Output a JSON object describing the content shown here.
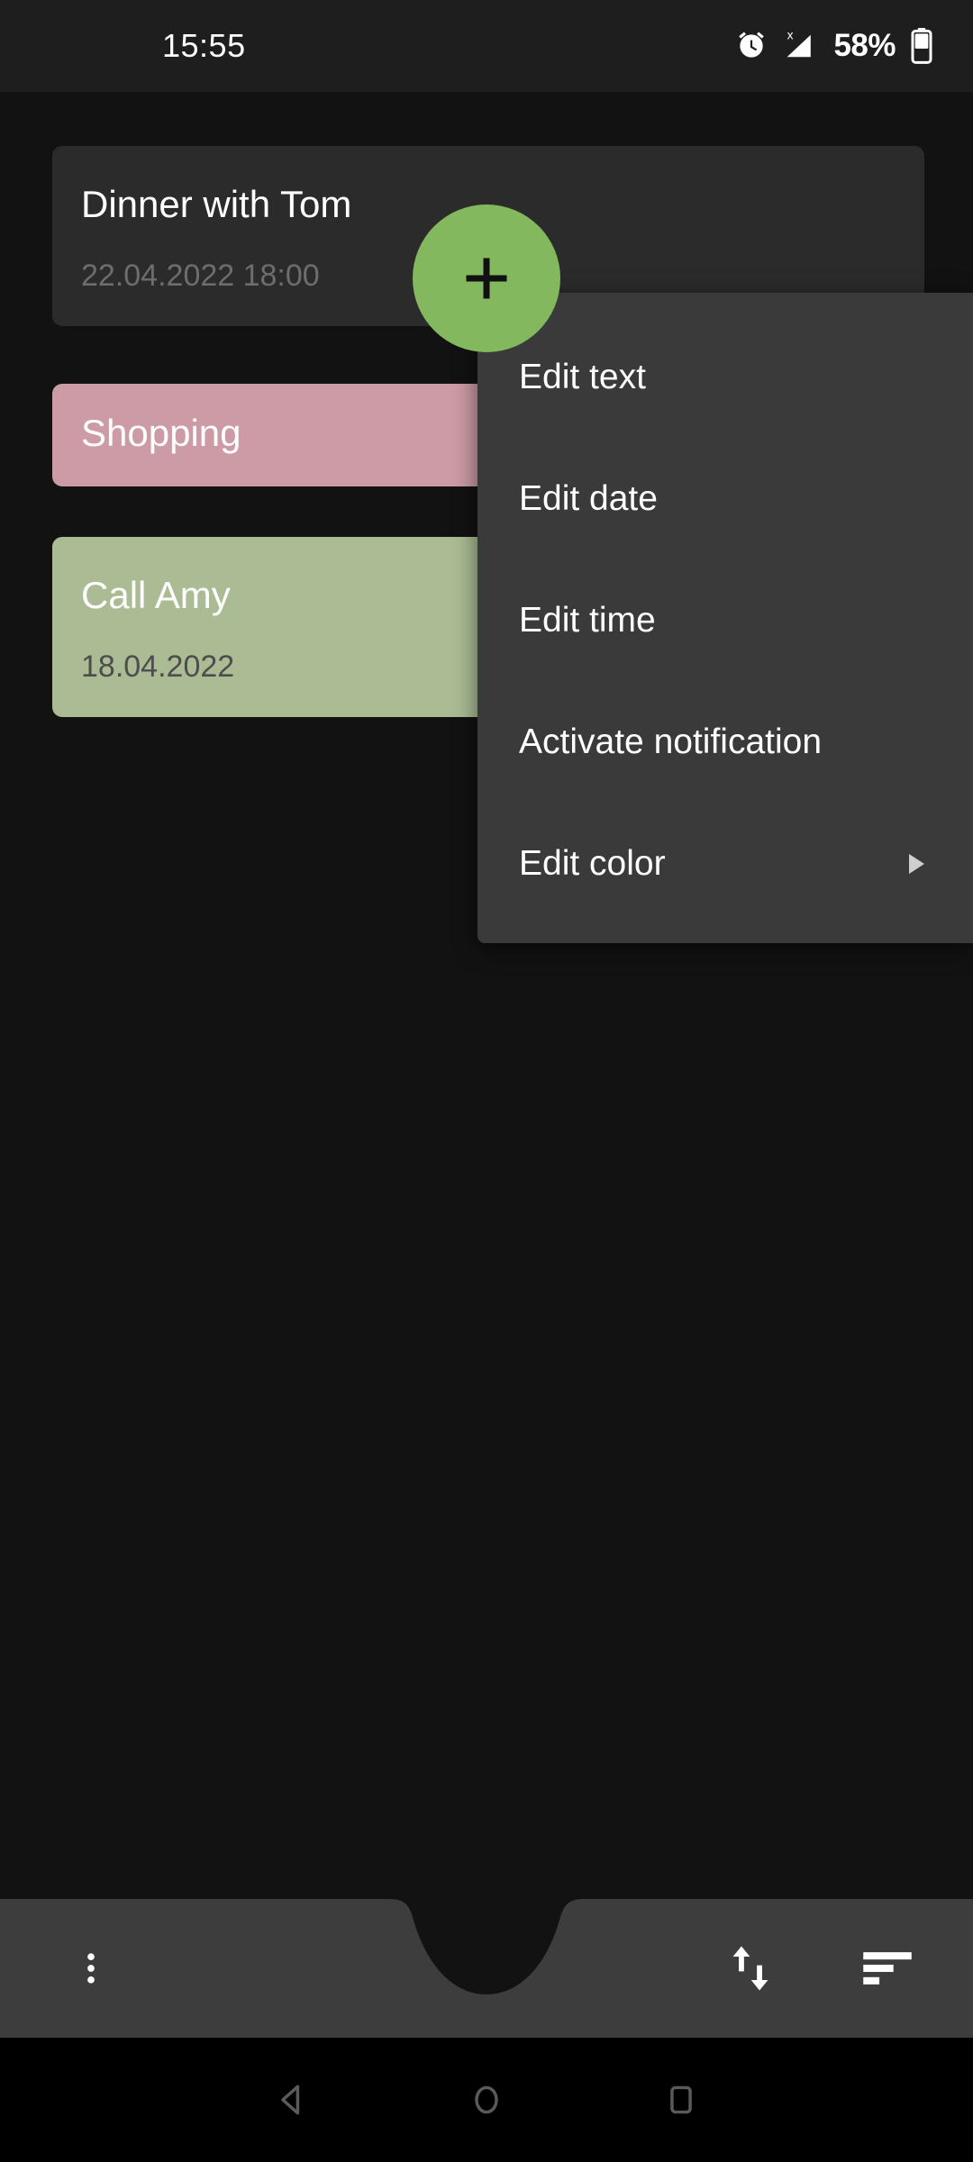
{
  "status_bar": {
    "time": "15:55",
    "battery_percent": "58%",
    "icons": [
      "alarm-icon",
      "signal-no-sim-icon",
      "battery-icon"
    ]
  },
  "notes": [
    {
      "title": "Dinner with Tom",
      "subtitle": "22.04.2022 18:00",
      "color": "#2b2b2b",
      "style": "dark"
    },
    {
      "title": "Shopping",
      "subtitle": "",
      "color": "#cc9ba5",
      "style": "pink"
    },
    {
      "title": "Call Amy",
      "subtitle": "18.04.2022",
      "color": "#abbc94",
      "style": "green"
    }
  ],
  "context_menu": {
    "items": [
      {
        "label": "Edit text",
        "has_submenu": false
      },
      {
        "label": "Edit date",
        "has_submenu": false
      },
      {
        "label": "Edit time",
        "has_submenu": false
      },
      {
        "label": "Activate notification",
        "has_submenu": false
      },
      {
        "label": "Edit color",
        "has_submenu": true
      }
    ],
    "background": "#3a3a3a"
  },
  "bottom_bar": {
    "background": "#3d3d3d",
    "overflow_label": "more-options",
    "sort_direction_label": "swap-vertical",
    "sort_label": "sort"
  },
  "fab": {
    "label": "+",
    "color": "#84b85f",
    "name": "add-note"
  },
  "nav_bar": {
    "back": "back",
    "home": "home",
    "recents": "recents"
  },
  "theme": {
    "page_background": "#121212",
    "status_bar_background": "#1e1e1e",
    "accent": "#84b85f"
  }
}
